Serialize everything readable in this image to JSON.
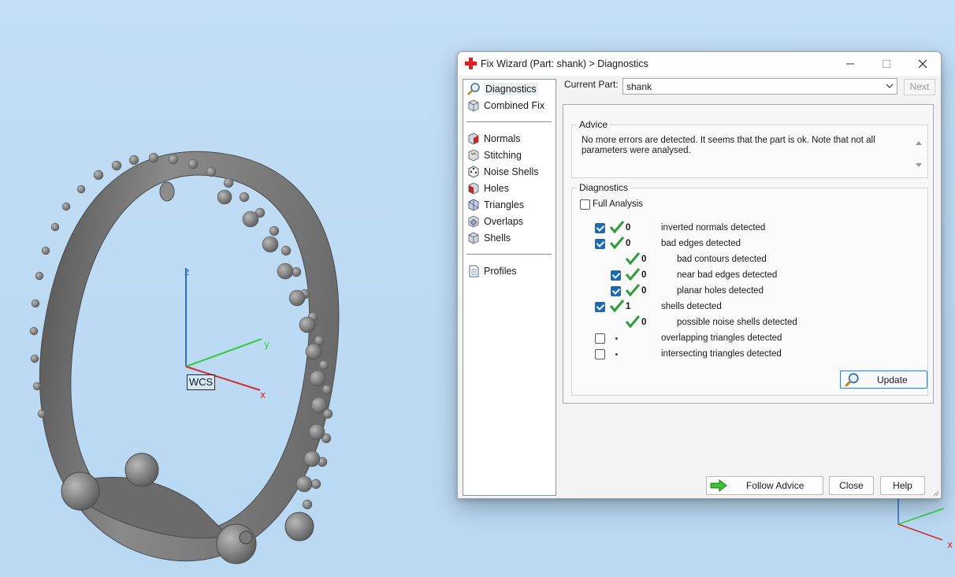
{
  "viewport": {
    "wcs_label": "WCS",
    "axis_x": "x",
    "axis_y": "y",
    "axis_z": "z"
  },
  "dialog": {
    "title": "Fix Wizard (Part: shank) > Diagnostics",
    "nav": {
      "top_items": [
        {
          "label": "Diagnostics",
          "icon": "magnifier-icon",
          "selected": true
        },
        {
          "label": "Combined Fix",
          "icon": "cube-icon"
        }
      ],
      "tool_items": [
        {
          "label": "Normals",
          "icon": "normals-cube-icon"
        },
        {
          "label": "Stitching",
          "icon": "stitching-cube-icon"
        },
        {
          "label": "Noise Shells",
          "icon": "dice-icon"
        },
        {
          "label": "Holes",
          "icon": "holes-cube-icon"
        },
        {
          "label": "Triangles",
          "icon": "triangles-cube-icon"
        },
        {
          "label": "Overlaps",
          "icon": "overlaps-cube-icon"
        },
        {
          "label": "Shells",
          "icon": "shells-cube-icon"
        }
      ],
      "bottom_items": [
        {
          "label": "Profiles",
          "icon": "document-icon"
        }
      ]
    },
    "current_part_label": "Current Part:",
    "current_part_value": "shank",
    "next_label": "Next",
    "advice": {
      "title": "Advice",
      "text": "No more errors are detected. It seems that the part is ok. Note that not all parameters were analysed."
    },
    "diagnostics": {
      "title": "Diagnostics",
      "full_analysis_label": "Full Analysis",
      "full_analysis_checked": false,
      "rows": [
        {
          "checkbox": true,
          "checked": true,
          "status": "ok",
          "count": "0",
          "label": "inverted normals detected",
          "indent": 0
        },
        {
          "checkbox": true,
          "checked": true,
          "status": "ok",
          "count": "0",
          "label": "bad edges detected",
          "indent": 0
        },
        {
          "checkbox": false,
          "checked": false,
          "status": "ok",
          "count": "0",
          "label": "bad contours detected",
          "indent": 1
        },
        {
          "checkbox": true,
          "checked": true,
          "status": "ok",
          "count": "0",
          "label": "near bad edges detected",
          "indent": 1
        },
        {
          "checkbox": true,
          "checked": true,
          "status": "ok",
          "count": "0",
          "label": "planar holes detected",
          "indent": 1
        },
        {
          "checkbox": true,
          "checked": true,
          "status": "ok",
          "count": "1",
          "label": "shells detected",
          "indent": 0
        },
        {
          "checkbox": false,
          "checked": false,
          "status": "ok",
          "count": "0",
          "label": "possible noise shells detected",
          "indent": 1
        },
        {
          "checkbox": true,
          "checked": false,
          "status": "none",
          "count": "",
          "label": "overlapping triangles detected",
          "indent": 0
        },
        {
          "checkbox": true,
          "checked": false,
          "status": "none",
          "count": "",
          "label": "intersecting triangles detected",
          "indent": 0
        }
      ],
      "update_label": "Update"
    },
    "buttons": {
      "follow_advice": "Follow Advice",
      "close": "Close",
      "help": "Help"
    },
    "colors": {
      "accent": "#1a6bb5",
      "tick_green": "#2e9e3a"
    }
  }
}
